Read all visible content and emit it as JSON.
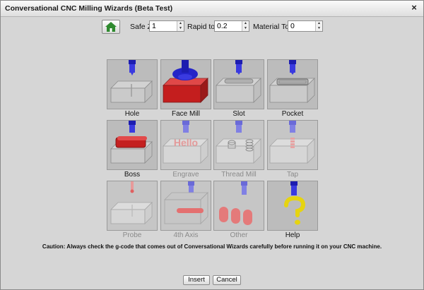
{
  "window": {
    "title": "Conversational CNC Milling Wizards (Beta Test)",
    "close_glyph": "×"
  },
  "toolbar": {
    "home_icon": "home-icon",
    "safe_z_label": "Safe Z",
    "safe_z_value": "1",
    "rapid_z_label": "Rapid to Z",
    "rapid_z_value": "0.2",
    "material_top_label": "Material Top Z",
    "material_top_value": "0"
  },
  "wizards": [
    {
      "label": "Hole",
      "icon": "hole-icon",
      "enabled": true
    },
    {
      "label": "Face Mill",
      "icon": "face-mill-icon",
      "enabled": true
    },
    {
      "label": "Slot",
      "icon": "slot-icon",
      "enabled": true
    },
    {
      "label": "Pocket",
      "icon": "pocket-icon",
      "enabled": true
    },
    {
      "label": "Boss",
      "icon": "boss-icon",
      "enabled": true
    },
    {
      "label": "Engrave",
      "icon": "engrave-icon",
      "enabled": false,
      "engrave_text": "Hello"
    },
    {
      "label": "Thread Mill",
      "icon": "thread-mill-icon",
      "enabled": false
    },
    {
      "label": "Tap",
      "icon": "tap-icon",
      "enabled": false
    },
    {
      "label": "Probe",
      "icon": "probe-icon",
      "enabled": false
    },
    {
      "label": "4th Axis",
      "icon": "4th-axis-icon",
      "enabled": false
    },
    {
      "label": "Other",
      "icon": "other-icon",
      "enabled": false
    },
    {
      "label": "Help",
      "icon": "help-icon",
      "enabled": true
    }
  ],
  "caution": "Caution: Always check the g-code that comes out of Conversational Wizards carefully before running it on your CNC machine.",
  "buttons": {
    "insert": "Insert",
    "cancel": "Cancel"
  },
  "colors": {
    "tool_blue": "#2a2ad8",
    "feature_red": "#d81c1c",
    "help_yellow": "#f0e020",
    "home_green": "#2f8a2f"
  }
}
